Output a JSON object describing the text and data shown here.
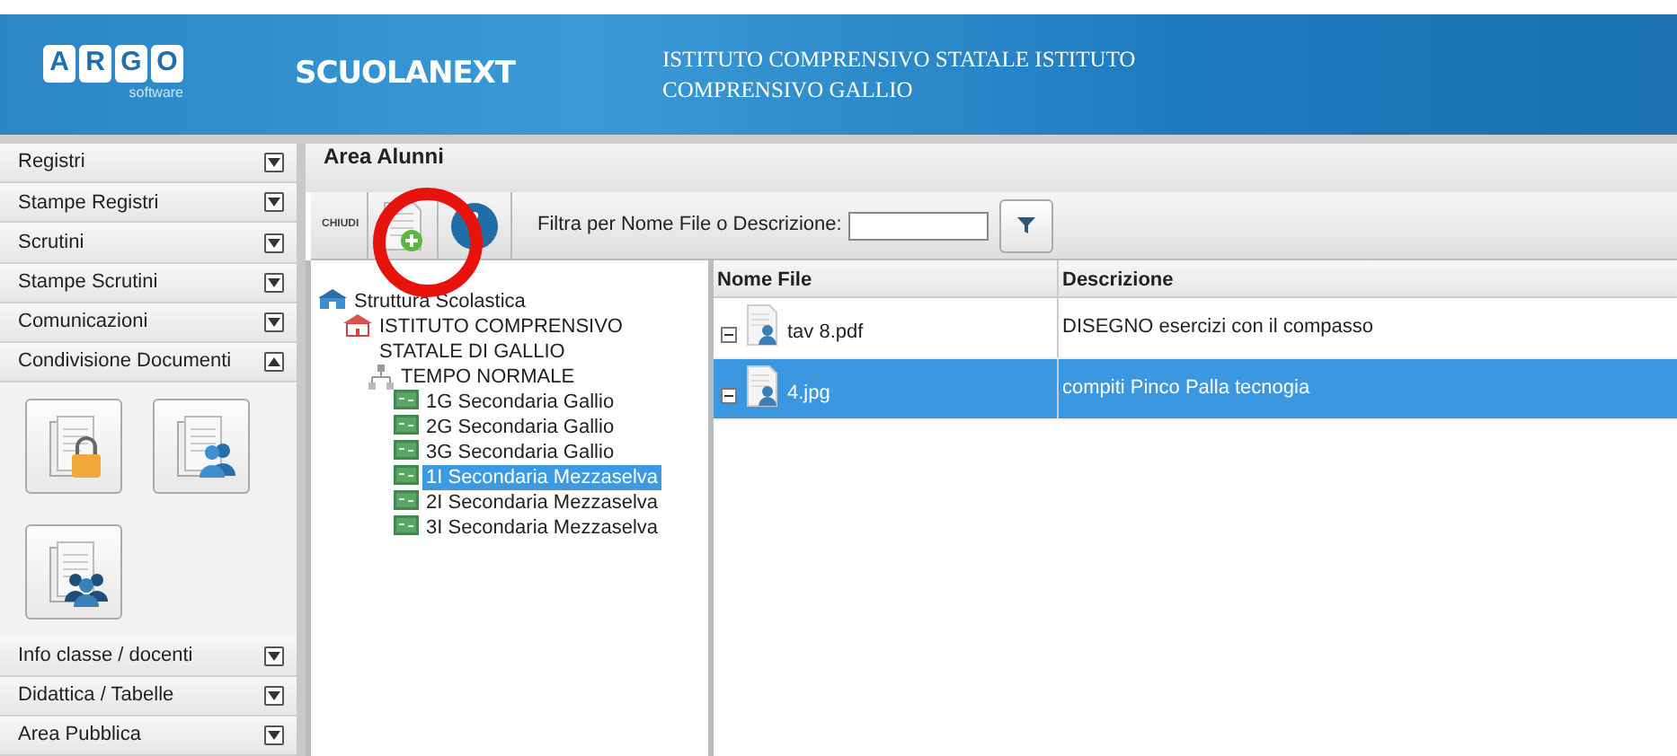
{
  "header": {
    "logo_letters": [
      "A",
      "R",
      "G",
      "O"
    ],
    "logo_caption": "software",
    "product": "SCUOLANEXT",
    "institute": "ISTITUTO COMPRENSIVO STATALE ISTITUTO COMPRENSIVO GALLIO"
  },
  "sidebar": {
    "sections": [
      {
        "label": "Registri",
        "expanded": false
      },
      {
        "label": "Stampe Registri",
        "expanded": false
      },
      {
        "label": "Scrutini",
        "expanded": false
      },
      {
        "label": "Stampe Scrutini",
        "expanded": false
      },
      {
        "label": "Comunicazioni",
        "expanded": false
      },
      {
        "label": "Condivisione Documenti",
        "expanded": true,
        "tiles": [
          {
            "kind": "locked"
          },
          {
            "kind": "user"
          },
          {
            "kind": "group"
          }
        ]
      },
      {
        "label": "Info classe / docenti",
        "expanded": false
      },
      {
        "label": "Didattica / Tabelle",
        "expanded": false
      },
      {
        "label": "Area Pubblica",
        "expanded": false
      }
    ]
  },
  "panel": {
    "title": "Area Alunni",
    "toolbar": {
      "close_label": "CHIUDI",
      "filter_label": "Filtra per Nome File o Descrizione:"
    },
    "tree": [
      {
        "label": "Struttura Scolastica",
        "kind": "root",
        "selected": false,
        "children": [
          {
            "label": "ISTITUTO COMPRENSIVO STATALE DI GALLIO",
            "kind": "school",
            "selected": false,
            "children": [
              {
                "label": "TEMPO NORMALE",
                "kind": "group",
                "selected": false,
                "children": [
                  {
                    "label": "1G Secondaria Gallio",
                    "kind": "class",
                    "selected": false
                  },
                  {
                    "label": "2G Secondaria Gallio",
                    "kind": "class",
                    "selected": false
                  },
                  {
                    "label": "3G Secondaria Gallio",
                    "kind": "class",
                    "selected": false
                  },
                  {
                    "label": "1I Secondaria Mezzaselva",
                    "kind": "class",
                    "selected": true
                  },
                  {
                    "label": "2I Secondaria Mezzaselva",
                    "kind": "class",
                    "selected": false
                  },
                  {
                    "label": "3I Secondaria Mezzaselva",
                    "kind": "class",
                    "selected": false
                  }
                ]
              }
            ]
          }
        ]
      }
    ],
    "table": {
      "columns": [
        "Nome File",
        "Descrizione"
      ],
      "rows": [
        {
          "file": "tav 8.pdf",
          "description": "DISEGNO esercizi con il compasso",
          "selected": false
        },
        {
          "file": "4.jpg",
          "description": "compiti Pinco Palla tecnogia",
          "selected": true
        }
      ]
    }
  }
}
